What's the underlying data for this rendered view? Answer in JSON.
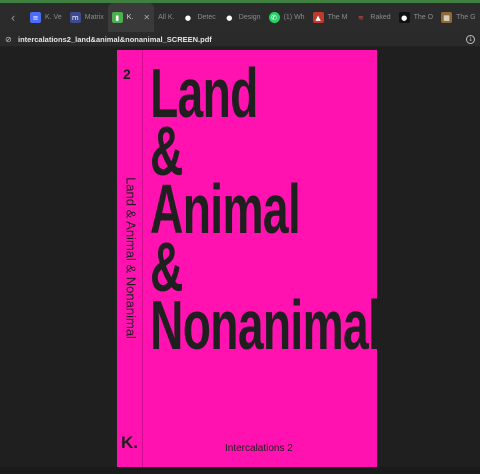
{
  "tabs": [
    {
      "label": "K. Ve",
      "icon": "doc-icon",
      "color": "#4a6cf7",
      "glyph": "≡"
    },
    {
      "label": "Matrix",
      "icon": "matrix-icon",
      "color": "#3d4a8f",
      "glyph": "m"
    },
    {
      "label": "K.",
      "icon": "book-icon",
      "color": "#4caf50",
      "glyph": "▮",
      "active": true
    },
    {
      "label": "All K.",
      "icon": "",
      "color": "",
      "glyph": ""
    },
    {
      "label": "Detec",
      "icon": "github-icon",
      "color": "#ffffff",
      "glyph": "●"
    },
    {
      "label": "Design",
      "icon": "github-icon",
      "color": "#ffffff",
      "glyph": "●"
    },
    {
      "label": "(1) Wh",
      "icon": "whatsapp-icon",
      "color": "#25d366",
      "glyph": "✆"
    },
    {
      "label": "The M",
      "icon": "magazine-icon",
      "color": "#c0392b",
      "glyph": "▲"
    },
    {
      "label": "Raked",
      "icon": "raked-icon",
      "color": "#e74c3c",
      "glyph": "≋"
    },
    {
      "label": "The O",
      "icon": "dark-icon",
      "color": "#222222",
      "glyph": "●"
    },
    {
      "label": "The G",
      "icon": "image-icon",
      "color": "#8e6a3a",
      "glyph": "▦"
    }
  ],
  "address": {
    "filename": "intercalations2_land&animal&nonanimal_SCREEN.pdf"
  },
  "cover": {
    "background": "#ff12b0",
    "volume_number": "2",
    "spine_title": "Land & Animal & Nonanimal",
    "title_lines": [
      "Land",
      "&",
      "Animal",
      "&",
      "Nonanimal"
    ],
    "publisher_logo": "K.",
    "series": "Intercalations 2"
  }
}
